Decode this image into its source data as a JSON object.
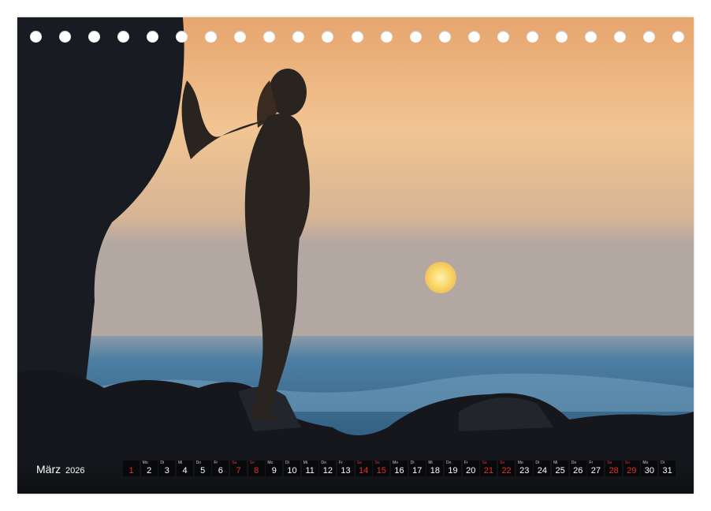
{
  "calendar": {
    "month": "März",
    "year": "2026",
    "days": [
      {
        "dow": "",
        "num": "1",
        "red": true
      },
      {
        "dow": "Mo",
        "num": "2",
        "red": false
      },
      {
        "dow": "Di",
        "num": "3",
        "red": false
      },
      {
        "dow": "Mi",
        "num": "4",
        "red": false
      },
      {
        "dow": "Do",
        "num": "5",
        "red": false
      },
      {
        "dow": "Fr",
        "num": "6",
        "red": false
      },
      {
        "dow": "Sa",
        "num": "7",
        "red": true
      },
      {
        "dow": "So",
        "num": "8",
        "red": true
      },
      {
        "dow": "Mo",
        "num": "9",
        "red": false
      },
      {
        "dow": "Di",
        "num": "10",
        "red": false
      },
      {
        "dow": "Mi",
        "num": "11",
        "red": false
      },
      {
        "dow": "Do",
        "num": "12",
        "red": false
      },
      {
        "dow": "Fr",
        "num": "13",
        "red": false
      },
      {
        "dow": "Sa",
        "num": "14",
        "red": true
      },
      {
        "dow": "So",
        "num": "15",
        "red": true
      },
      {
        "dow": "Mo",
        "num": "16",
        "red": false
      },
      {
        "dow": "Di",
        "num": "17",
        "red": false
      },
      {
        "dow": "Mi",
        "num": "18",
        "red": false
      },
      {
        "dow": "Do",
        "num": "19",
        "red": false
      },
      {
        "dow": "Fr",
        "num": "20",
        "red": false
      },
      {
        "dow": "Sa",
        "num": "21",
        "red": true
      },
      {
        "dow": "So",
        "num": "22",
        "red": true
      },
      {
        "dow": "Mo",
        "num": "23",
        "red": false
      },
      {
        "dow": "Di",
        "num": "24",
        "red": false
      },
      {
        "dow": "Mi",
        "num": "25",
        "red": false
      },
      {
        "dow": "Do",
        "num": "26",
        "red": false
      },
      {
        "dow": "Fr",
        "num": "27",
        "red": false
      },
      {
        "dow": "Sa",
        "num": "28",
        "red": true
      },
      {
        "dow": "So",
        "num": "29",
        "red": true
      },
      {
        "dow": "Mo",
        "num": "30",
        "red": false
      },
      {
        "dow": "Di",
        "num": "31",
        "red": false
      }
    ]
  },
  "binding_holes": 23,
  "colors": {
    "sky_top": "#e7a56e",
    "sky_mid": "#f0c48f",
    "sky_horizon": "#b7a9a0",
    "sea": "#3d6f92",
    "sun": "#fbd86a",
    "silhouette": "#1c1f26",
    "weekend": "#e0322a"
  }
}
